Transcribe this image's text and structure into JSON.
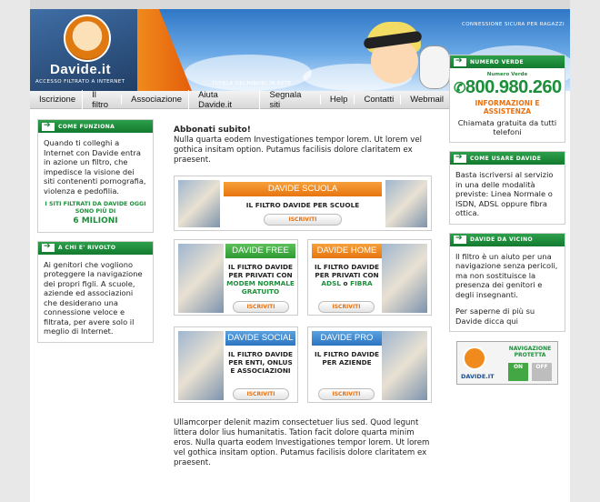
{
  "header": {
    "logo_text": "Davide.it",
    "logo_subtitle": "ACCESSO FILTRATO A INTERNET",
    "top_right": "CONNESSIONE SICURA PER RAGAZZI",
    "tagline": "TUTELA DEI MINORI IN RETE"
  },
  "nav": {
    "items": [
      "Iscrizione",
      "Il filtro",
      "Associazione",
      "Aiuta Davide.it",
      "Segnala siti",
      "Help",
      "Contatti",
      "Webmail"
    ]
  },
  "left": {
    "come_funziona": {
      "title": "COME FUNZIONA",
      "body": "Quando ti colleghi a Internet con Davide entra in azione un filtro, che impedisce la visione dei siti contenenti pornografia, violenza e pedofilia.",
      "note": "I SITI FILTRATI DA DAVIDE OGGI SONO PIÙ DI",
      "count": "6 MILIONI"
    },
    "a_chi": {
      "title": "A CHI E' RIVOLTO",
      "body": "Ai genitori che vogliono proteggere la navigazione dei propri figli. A scuole, aziende ed associazioni che desiderano una connessione veloce e filtrata, per avere solo il meglio di Internet."
    }
  },
  "right": {
    "numero_verde": {
      "title": "NUMERO VERDE",
      "label": "Numero Verde",
      "number": "800.980.260",
      "info": "INFORMAZIONI E ASSISTENZA",
      "note": "Chiamata gratuita da tutti telefoni"
    },
    "come_usare": {
      "title": "COME USARE DAVIDE",
      "body": "Basta iscriversi al servizio in una delle modalità previste: Linea Normale o ISDN, ADSL oppure fibra ottica."
    },
    "da_vicino": {
      "title": "DAVIDE DA VICINO",
      "body": "Il filtro è un aiuto per una navigazione senza pericoli, ma non sostituisce la presenza dei genitori e degli insegnanti.",
      "body2": "Per saperne di più su Davide dicca qui"
    },
    "badge": {
      "name": "DAVIDE.IT",
      "title": "NAVIGAZIONE PROTETTA",
      "on": "ON",
      "off": "OFF"
    }
  },
  "main": {
    "title": "Abbonati subito!",
    "intro": "Nulla quarta eodem Investigationes tempor lorem. Ut lorem vel gothica insitam option. Putamus facilisis dolore claritatem ex praesent.",
    "scuola": {
      "title": "DAVIDE SCUOLA",
      "desc": "IL FILTRO DAVIDE PER SCUOLE",
      "button": "ISCRIVITI"
    },
    "free": {
      "title": "DAVIDE FREE",
      "desc": "IL FILTRO DAVIDE PER PRIVATI CON",
      "highlight": "MODEM NORMALE GRATUITO",
      "button": "ISCRIVITI"
    },
    "home": {
      "title": "DAVIDE HOME",
      "desc": "IL FILTRO DAVIDE PER PRIVATI CON",
      "highlight_a": "ADSL",
      "joiner": " o ",
      "highlight_b": "FIBRA",
      "button": "ISCRIVITI"
    },
    "social": {
      "title": "DAVIDE SOCIAL",
      "desc": "IL FILTRO DAVIDE PER ENTI, ONLUS E ASSOCIAZIONI",
      "button": "ISCRIVITI"
    },
    "pro": {
      "title": "DAVIDE PRO",
      "desc": "IL FILTRO DAVIDE PER AZIENDE",
      "button": "ISCRIVITI"
    },
    "outro": "Ullamcorper delenit mazim consectetuer lius sed. Quod legunt littera dolor lius humanitatis. Tation facit dolore quarta minim eros. Nulla quarta eodem Investigationes tempor lorem. Ut lorem vel gothica insitam option. Putamus facilisis dolore claritatem ex praesent."
  }
}
